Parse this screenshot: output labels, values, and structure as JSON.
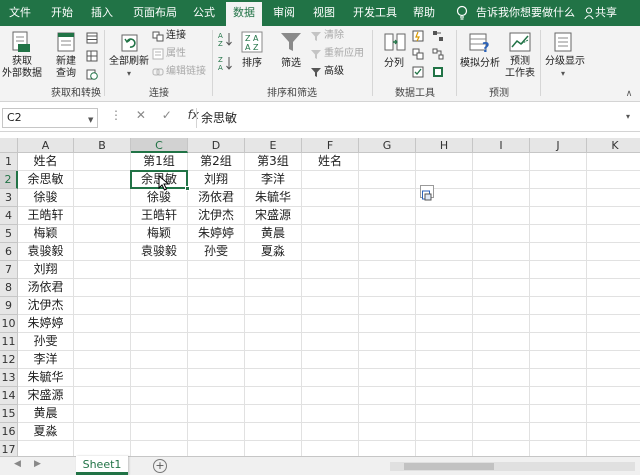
{
  "ribbon_tabs": [
    {
      "label": "文件",
      "active": false
    },
    {
      "label": "开始",
      "active": false
    },
    {
      "label": "插入",
      "active": false
    },
    {
      "label": "页面布局",
      "active": false
    },
    {
      "label": "公式",
      "active": false
    },
    {
      "label": "数据",
      "active": true
    },
    {
      "label": "审阅",
      "active": false
    },
    {
      "label": "视图",
      "active": false
    },
    {
      "label": "开发工具",
      "active": false
    },
    {
      "label": "帮助",
      "active": false
    }
  ],
  "tell_me": "告诉我你想要做什么",
  "share": "共享",
  "groups": {
    "get_transform": {
      "label": "获取和转换",
      "get_external_1": "获取",
      "get_external_2": "外部数据",
      "new_query_1": "新建",
      "new_query_2": "查询"
    },
    "connections": {
      "label": "连接",
      "refresh_all": "全部刷新",
      "connections": "连接",
      "properties": "属性",
      "edit_links": "编辑链接"
    },
    "sort_filter": {
      "label": "排序和筛选",
      "sort": "排序",
      "filter": "筛选",
      "clear": "清除",
      "reapply": "重新应用",
      "advanced": "高级"
    },
    "data_tools": {
      "label": "数据工具",
      "text_to_columns": "分列"
    },
    "forecast": {
      "label": "预测",
      "what_if": "模拟分析",
      "forecast_sheet_1": "预测",
      "forecast_sheet_2": "工作表"
    },
    "outline": {
      "label": "分级显示"
    }
  },
  "formula_bar": {
    "name_box": "C2",
    "fx": "fx",
    "formula": "余思敏"
  },
  "sheet": {
    "columns": [
      "A",
      "B",
      "C",
      "D",
      "E",
      "F",
      "G",
      "H",
      "I",
      "J",
      "K"
    ],
    "selected_column": "C",
    "selected_row": 2,
    "row_count": 17,
    "rows": [
      [
        "姓名",
        "",
        "第1组",
        "第2组",
        "第3组",
        "姓名",
        "",
        "",
        "",
        "",
        ""
      ],
      [
        "余思敏",
        "",
        "余思敏",
        "刘翔",
        "李洋",
        "",
        "",
        "",
        "",
        "",
        ""
      ],
      [
        "徐骏",
        "",
        "徐骏",
        "汤依君",
        "朱毓华",
        "",
        "",
        "",
        "",
        "",
        ""
      ],
      [
        "王皓轩",
        "",
        "王皓轩",
        "沈伊杰",
        "宋盛源",
        "",
        "",
        "",
        "",
        "",
        ""
      ],
      [
        "梅颖",
        "",
        "梅颖",
        "朱婷婷",
        "黄晨",
        "",
        "",
        "",
        "",
        "",
        ""
      ],
      [
        "袁骏毅",
        "",
        "袁骏毅",
        "孙雯",
        "夏淼",
        "",
        "",
        "",
        "",
        "",
        ""
      ],
      [
        "刘翔",
        "",
        "",
        "",
        "",
        "",
        "",
        "",
        "",
        "",
        ""
      ],
      [
        "汤依君",
        "",
        "",
        "",
        "",
        "",
        "",
        "",
        "",
        "",
        ""
      ],
      [
        "沈伊杰",
        "",
        "",
        "",
        "",
        "",
        "",
        "",
        "",
        "",
        ""
      ],
      [
        "朱婷婷",
        "",
        "",
        "",
        "",
        "",
        "",
        "",
        "",
        "",
        ""
      ],
      [
        "孙雯",
        "",
        "",
        "",
        "",
        "",
        "",
        "",
        "",
        "",
        ""
      ],
      [
        "李洋",
        "",
        "",
        "",
        "",
        "",
        "",
        "",
        "",
        "",
        ""
      ],
      [
        "朱毓华",
        "",
        "",
        "",
        "",
        "",
        "",
        "",
        "",
        "",
        ""
      ],
      [
        "宋盛源",
        "",
        "",
        "",
        "",
        "",
        "",
        "",
        "",
        "",
        ""
      ],
      [
        "黄晨",
        "",
        "",
        "",
        "",
        "",
        "",
        "",
        "",
        "",
        ""
      ],
      [
        "夏淼",
        "",
        "",
        "",
        "",
        "",
        "",
        "",
        "",
        "",
        ""
      ],
      [
        "",
        "",
        "",
        "",
        "",
        "",
        "",
        "",
        "",
        "",
        ""
      ]
    ]
  },
  "sheet_tabs": [
    {
      "label": "Sheet1",
      "active": true
    }
  ],
  "colors": {
    "accent": "#217346",
    "ribbon_bg": "#f3f3f3",
    "header_bg": "#e6e6e6"
  }
}
